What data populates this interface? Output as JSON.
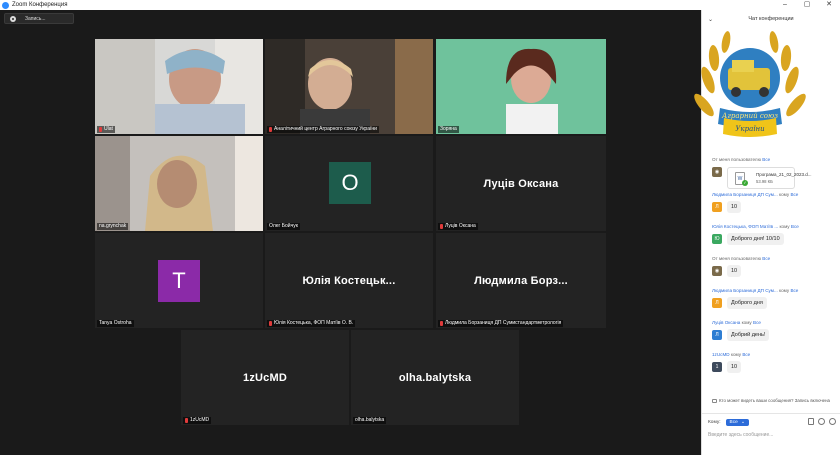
{
  "window": {
    "title": "Zoom Конференция"
  },
  "recording": {
    "label": "Запись..."
  },
  "tiles": [
    {
      "name": "Ulat"
    },
    {
      "name": "Аналітичний центр Аграрного союзу України"
    },
    {
      "name": "Зоряна"
    },
    {
      "name": "na.grynchak"
    },
    {
      "name": "Олег Бойчук",
      "initial": "О",
      "color": "#1d5c4c"
    },
    {
      "name": "Луців Оксана",
      "display": "Луців Оксана"
    },
    {
      "name": "Tanya Ostroha",
      "initial": "T",
      "color": "#8b2aa8"
    },
    {
      "name": "Юлія Костецька, ФОП Матіїв О. В.",
      "display": "Юлія Костецьк..."
    },
    {
      "name": "Людмила Борзаниця ДП Сумистандартметрологія",
      "display": "Людмила Борз..."
    },
    {
      "name": "1zUcMD",
      "display": "1zUcMD"
    },
    {
      "name": "olha.balytska",
      "display": "olha.balytska"
    }
  ],
  "chat": {
    "title": "Чат конференции",
    "logo_text": "Аграрний союз України",
    "messages": [
      {
        "from": "От меня пользователю",
        "to": "Все",
        "file_name": "Програма_21_02_2023.d...",
        "file_size": "53.98 КБ"
      },
      {
        "from": "Людмила Борзаниця ДП Сум...",
        "to_prefix": "кому",
        "to": "Все",
        "initial": "Л",
        "avatar_color": "#f0a020",
        "text": "10"
      },
      {
        "from": "Юлія Костецька, ФОП Матіїв ...",
        "to_prefix": "кому",
        "to": "Все",
        "initial": "Ю",
        "avatar_color": "#3aa860",
        "text": "Доброго дня! 10/10"
      },
      {
        "from": "От меня пользователю",
        "to": "Все",
        "text": "10"
      },
      {
        "from": "Людмила Борзаниця ДП Сум...",
        "to_prefix": "кому",
        "to": "Все",
        "initial": "Л",
        "avatar_color": "#f0a020",
        "text": "Доброго дня"
      },
      {
        "from": "Луців Оксана",
        "to_prefix": "кому",
        "to": "Все",
        "initial": "Л",
        "avatar_color": "#2d7dd2",
        "text": "Добрий день!"
      },
      {
        "from": "1zUcMD",
        "to_prefix": "кому",
        "to": "Все",
        "initial": "1",
        "avatar_color": "#3d4a5c",
        "text": "10"
      }
    ],
    "notice": "Кто может видеть ваши сообщения? Запись включена",
    "to_label": "Кому:",
    "to_value": "Все",
    "input_placeholder": "Введите здесь сообщение..."
  }
}
